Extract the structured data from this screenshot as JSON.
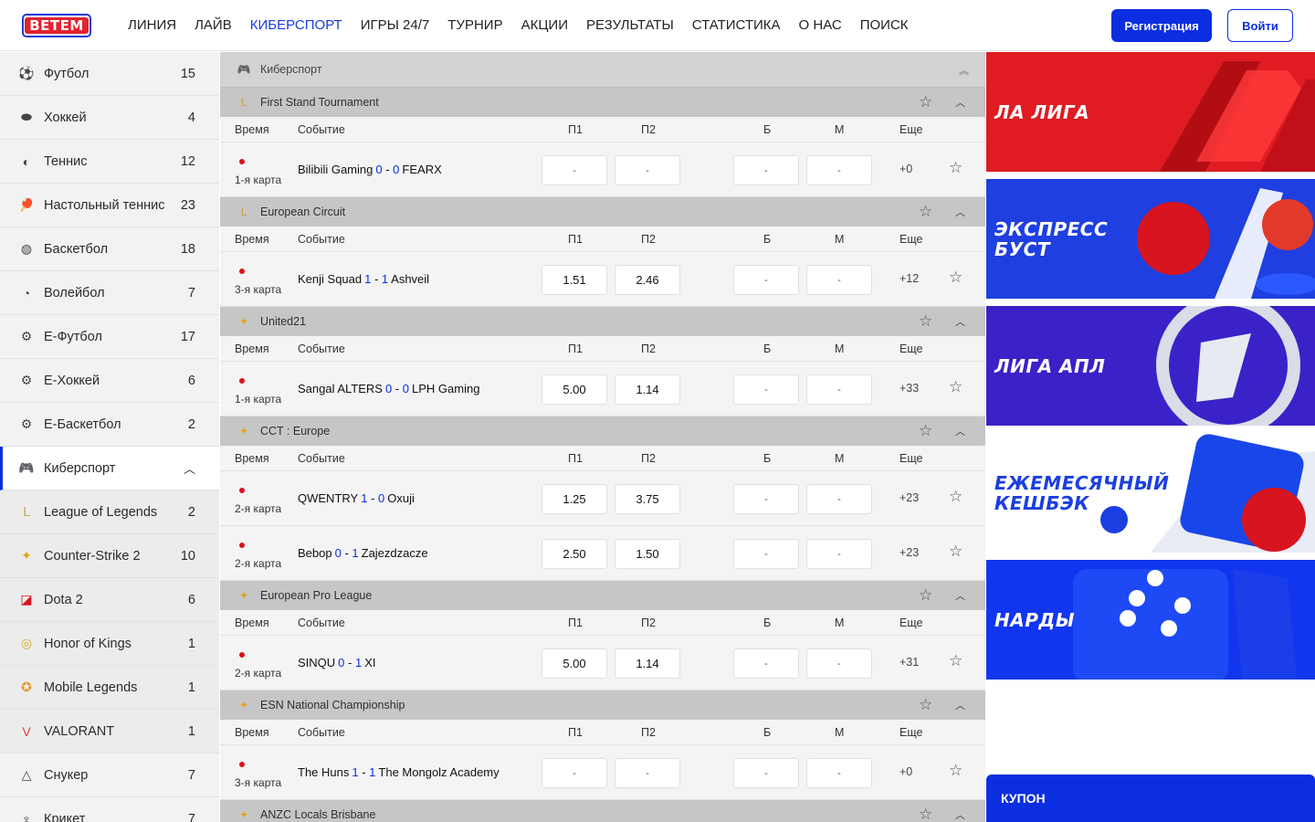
{
  "header": {
    "logo_text": "BETEM",
    "nav": [
      "ЛИНИЯ",
      "ЛАЙВ",
      "КИБЕРСПОРТ",
      "ИГРЫ 24/7",
      "ТУРНИР",
      "АКЦИИ",
      "РЕЗУЛЬТАТЫ",
      "СТАТИСТИКА",
      "О НАС",
      "ПОИСК"
    ],
    "active_nav": "КИБЕРСПОРТ",
    "register_label": "Регистрация",
    "login_label": "Войти"
  },
  "sidebar": {
    "items": [
      {
        "label": "Футбол",
        "count": "15",
        "icon": "soccer-ball-icon"
      },
      {
        "label": "Хоккей",
        "count": "4",
        "icon": "hockey-puck-icon"
      },
      {
        "label": "Теннис",
        "count": "12",
        "icon": "tennis-ball-icon"
      },
      {
        "label": "Настольный теннис",
        "count": "23",
        "icon": "table-tennis-icon"
      },
      {
        "label": "Баскетбол",
        "count": "18",
        "icon": "basketball-icon"
      },
      {
        "label": "Волейбол",
        "count": "7",
        "icon": "volleyball-icon"
      },
      {
        "label": "Е-Футбол",
        "count": "17",
        "icon": "efootball-icon"
      },
      {
        "label": "Е-Хоккей",
        "count": "6",
        "icon": "ehockey-icon"
      },
      {
        "label": "Е-Баскетбол",
        "count": "2",
        "icon": "ebasketball-icon"
      },
      {
        "label": "Киберспорт",
        "count": "",
        "icon": "gamepad-icon"
      },
      {
        "label": "League of Legends",
        "count": "2",
        "icon": "lol-icon"
      },
      {
        "label": "Counter-Strike 2",
        "count": "10",
        "icon": "cs2-icon"
      },
      {
        "label": "Dota 2",
        "count": "6",
        "icon": "dota2-icon"
      },
      {
        "label": "Honor of Kings",
        "count": "1",
        "icon": "honor-of-kings-icon"
      },
      {
        "label": "Mobile Legends",
        "count": "1",
        "icon": "mobile-legends-icon"
      },
      {
        "label": "VALORANT",
        "count": "1",
        "icon": "valorant-icon"
      },
      {
        "label": "Снукер",
        "count": "7",
        "icon": "snooker-icon"
      },
      {
        "label": "Крикет",
        "count": "7",
        "icon": "cricket-icon"
      }
    ]
  },
  "main": {
    "section_title": "Киберспорт",
    "columns": {
      "time": "Время",
      "event": "Событие",
      "p1": "П1",
      "p2": "П2",
      "b": "Б",
      "m": "М",
      "more": "Еще"
    },
    "tournaments": [
      {
        "name": "First Stand Tournament",
        "icon": "lol-icon",
        "events": [
          {
            "period": "1-я карта",
            "team1": "Bilibili Gaming",
            "s1": "0",
            "s2": "0",
            "team2": "FEARX",
            "p1": "-",
            "p2": "-",
            "b": "-",
            "m": "-",
            "more": "+0"
          }
        ]
      },
      {
        "name": "European Circuit",
        "icon": "lol-icon",
        "events": [
          {
            "period": "3-я карта",
            "team1": "Kenji Squad",
            "s1": "1",
            "s2": "1",
            "team2": "Ashveil",
            "p1": "1.51",
            "p2": "2.46",
            "b": "-",
            "m": "-",
            "more": "+12"
          }
        ]
      },
      {
        "name": "United21",
        "icon": "cs2-icon",
        "events": [
          {
            "period": "1-я карта",
            "team1": "Sangal ALTERS",
            "s1": "0",
            "s2": "0",
            "team2": "LPH Gaming",
            "p1": "5.00",
            "p2": "1.14",
            "b": "-",
            "m": "-",
            "more": "+33"
          }
        ]
      },
      {
        "name": "CCT : Europe",
        "icon": "cs2-icon",
        "events": [
          {
            "period": "2-я карта",
            "team1": "QWENTRY",
            "s1": "1",
            "s2": "0",
            "team2": "Oxuji",
            "p1": "1.25",
            "p2": "3.75",
            "b": "-",
            "m": "-",
            "more": "+23"
          },
          {
            "period": "2-я карта",
            "team1": "Bebop",
            "s1": "0",
            "s2": "1",
            "team2": "Zajezdzacze",
            "p1": "2.50",
            "p2": "1.50",
            "b": "-",
            "m": "-",
            "more": "+23"
          }
        ]
      },
      {
        "name": "European Pro League",
        "icon": "cs2-icon",
        "events": [
          {
            "period": "2-я карта",
            "team1": "SINQU",
            "s1": "0",
            "s2": "1",
            "team2": "XI",
            "p1": "5.00",
            "p2": "1.14",
            "b": "-",
            "m": "-",
            "more": "+31"
          }
        ]
      },
      {
        "name": "ESN National Championship",
        "icon": "cs2-icon",
        "events": [
          {
            "period": "3-я карта",
            "team1": "The Huns",
            "s1": "1",
            "s2": "1",
            "team2": "The Mongolz Academy",
            "p1": "-",
            "p2": "-",
            "b": "-",
            "m": "-",
            "more": "+0"
          }
        ]
      },
      {
        "name": "ANZC Locals Brisbane",
        "icon": "cs2-icon",
        "events": []
      }
    ]
  },
  "banners": [
    {
      "text": "ЛА ЛИГА",
      "bg": "#e01b22"
    },
    {
      "text": "ЭКСПРЕСС\nБУСТ",
      "bg": "#1f3fe0"
    },
    {
      "text": "ЛИГА АПЛ",
      "bg": "#3a22c8"
    },
    {
      "text": "ЕЖЕМЕСЯЧНЫЙ\nКЕШБЭК",
      "bg": "#ffffff"
    },
    {
      "text": "НАРДЫ",
      "bg": "#1235f0"
    }
  ],
  "coupon_label": "КУПОН",
  "colors": {
    "accent": "#0b2ee0",
    "live": "#d8141f",
    "score": "#0b2ee0"
  }
}
